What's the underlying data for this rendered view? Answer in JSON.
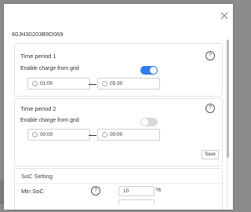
{
  "dialog": {
    "serial": "60JH30203B9D069",
    "close_icon": "close-icon"
  },
  "time_periods": [
    {
      "title": "Time period 1",
      "enable_label": "Enable charge from grid",
      "enabled": true,
      "start": "01:00",
      "end": "05:30",
      "help": "?"
    },
    {
      "title": "Time period 2",
      "enable_label": "Enable charge from grid",
      "enabled": false,
      "start": "00:00",
      "end": "00:00",
      "help": "?"
    }
  ],
  "save_label": "Save",
  "soc": {
    "title": "SoC Setting",
    "min_label": "Min SoC",
    "min_value": "10",
    "unit": "%",
    "help": "?"
  },
  "colors": {
    "toggle_on": "#2f7fe8",
    "toggle_off": "#d9d9d9"
  }
}
